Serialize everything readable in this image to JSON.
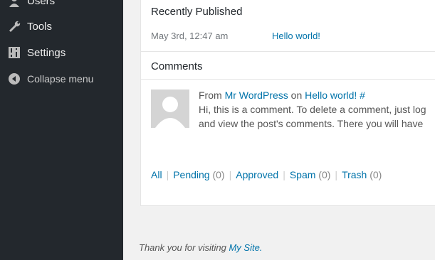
{
  "sidebar": {
    "items": [
      {
        "label": "Users",
        "icon": "users-icon"
      },
      {
        "label": "Tools",
        "icon": "wrench-icon"
      },
      {
        "label": "Settings",
        "icon": "settings-icon"
      }
    ],
    "collapse_label": "Collapse menu"
  },
  "recently_published": {
    "title": "Recently Published",
    "date": "May 3rd, 12:47 am",
    "post_link": "Hello world!"
  },
  "comments": {
    "title": "Comments",
    "item": {
      "from_prefix": "From",
      "author": "Mr WordPress",
      "on_word": "on",
      "post": "Hello world!",
      "hash": "#",
      "line1": "Hi, this is a comment. To delete a comment, just log",
      "line2": "and view the post's comments. There you will have"
    },
    "filters": [
      {
        "label": "All",
        "count": ""
      },
      {
        "label": "Pending",
        "count": "(0)"
      },
      {
        "label": "Approved",
        "count": ""
      },
      {
        "label": "Spam",
        "count": "(0)"
      },
      {
        "label": "Trash",
        "count": "(0)"
      }
    ]
  },
  "footer": {
    "prefix": "Thank you for visiting",
    "site": "My Site."
  },
  "colors": {
    "sidebar_bg": "#23282d",
    "link": "#0073aa",
    "page_bg": "#f1f1f1"
  }
}
